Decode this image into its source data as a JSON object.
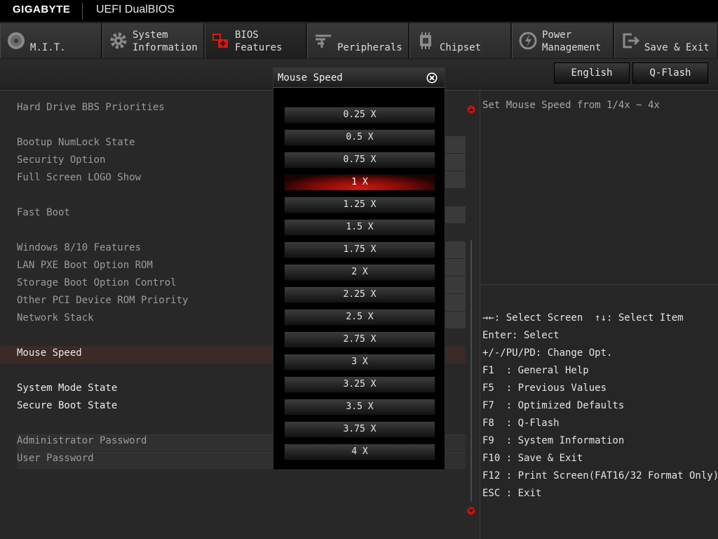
{
  "header": {
    "brand": "GIGABYTE",
    "product": "UEFI DualBIOS"
  },
  "tabs": [
    {
      "label": "M.I.T.",
      "icon": "disc-icon"
    },
    {
      "label": "System\nInformation",
      "icon": "gear-icon"
    },
    {
      "label": "BIOS\nFeatures",
      "icon": "bios-features-icon"
    },
    {
      "label": "Peripherals",
      "icon": "peripherals-icon"
    },
    {
      "label": "Chipset",
      "icon": "chipset-icon"
    },
    {
      "label": "Power\nManagement",
      "icon": "power-icon"
    },
    {
      "label": "Save & Exit",
      "icon": "save-exit-icon"
    }
  ],
  "active_tab": "BIOS Features",
  "buttons": {
    "language": "English",
    "qflash": "Q-Flash"
  },
  "settings": [
    {
      "label": "Hard Drive BBS Priorities"
    },
    {
      "label": "Bootup NumLock State"
    },
    {
      "label": "Security Option"
    },
    {
      "label": "Full Screen LOGO Show"
    },
    {
      "label": "Fast Boot"
    },
    {
      "label": "Windows 8/10 Features"
    },
    {
      "label": "LAN PXE Boot Option ROM"
    },
    {
      "label": "Storage Boot Option Control"
    },
    {
      "label": "Other PCI Device ROM Priority"
    },
    {
      "label": "Network Stack"
    },
    {
      "label": "Mouse Speed"
    },
    {
      "label": "System Mode State"
    },
    {
      "label": "Secure Boot State"
    },
    {
      "label": "Administrator Password"
    },
    {
      "label": "User Password"
    }
  ],
  "popup": {
    "title": "Mouse Speed",
    "options": [
      "0.25 X",
      "0.5 X",
      "0.75 X",
      "1 X",
      "1.25 X",
      "1.5 X",
      "1.75 X",
      "2 X",
      "2.25 X",
      "2.5 X",
      "2.75 X",
      "3 X",
      "3.25 X",
      "3.5 X",
      "3.75 X",
      "4 X"
    ],
    "selected": "1 X"
  },
  "help": {
    "description": "Set Mouse Speed from 1/4x ~ 4x"
  },
  "keys": [
    "→←: Select Screen  ↑↓: Select Item",
    "Enter: Select",
    "+/-/PU/PD: Change Opt.",
    "F1  : General Help",
    "F5  : Previous Values",
    "F7  : Optimized Defaults",
    "F8  : Q-Flash",
    "F9  : System Information",
    "F10 : Save & Exit",
    "F12 : Print Screen(FAT16/32 Format Only)",
    "ESC : Exit"
  ],
  "colors": {
    "accent": "#c8140c",
    "background": "#282828",
    "text": "#9c9c9c"
  }
}
